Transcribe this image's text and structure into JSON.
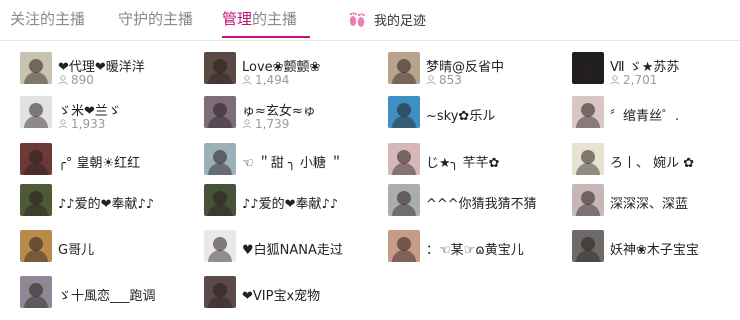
{
  "tabs": [
    {
      "label": "关注的主播"
    },
    {
      "label": "守护的主播"
    },
    {
      "label_highlight": "管理",
      "label_rest": "的主播"
    },
    {
      "label": "我的足迹"
    }
  ],
  "colors": {
    "accent": "#c4127a",
    "count": "#9b9b9b"
  },
  "icons": {
    "footprints": "footprints-icon",
    "person": "person-icon"
  },
  "anchors": [
    {
      "name": "❤代理❤暖洋洋",
      "count": "890",
      "avatar_color": "#c9c2b0"
    },
    {
      "name": "Love❀颤颤❀",
      "count": "1,494",
      "avatar_color": "#5a4a44"
    },
    {
      "name": "梦晴@反省中",
      "count": "853",
      "avatar_color": "#b9a38a"
    },
    {
      "name": "Ⅶ ゞ★苏苏",
      "count": "2,701",
      "avatar_color": "#1f1f1f"
    },
    {
      "name": "ゞ米❤兰ゞ",
      "count": "1,933",
      "avatar_color": "#e2e2e2"
    },
    {
      "name": "ゅ≈玄女≈ゅ",
      "count": "1,739",
      "avatar_color": "#7d6c7a"
    },
    {
      "name": "~sky✿乐ル",
      "count": "",
      "avatar_color": "#3d8fc4"
    },
    {
      "name": "〞绾青丝゜.",
      "count": "",
      "avatar_color": "#d8c6c3"
    },
    {
      "name": "╭° 皇朝☀红红",
      "count": "",
      "avatar_color": "#6b3a36"
    },
    {
      "name": "☜ ＂甜 ╮ 小糖 ＂",
      "count": "",
      "avatar_color": "#9cb0b8"
    },
    {
      "name": "じ★╮ 芊芊✿",
      "count": "",
      "avatar_color": "#d6b8b8"
    },
    {
      "name": "ろ丨、 婉ル ✿",
      "count": "",
      "avatar_color": "#e8e2d0"
    },
    {
      "name": "♪♪爱的❤奉献♪♪",
      "count": "",
      "avatar_color": "#4d5a35"
    },
    {
      "name": "♪♪爱的❤奉献♪♪",
      "count": "",
      "avatar_color": "#47523a"
    },
    {
      "name": "^^^你猜我猜不猜",
      "count": "",
      "avatar_color": "#a9adae"
    },
    {
      "name": "深深深、深蓝",
      "count": "",
      "avatar_color": "#c8b5b6"
    },
    {
      "name": "G哥儿",
      "count": "",
      "avatar_color": "#b98a4a"
    },
    {
      "name": "♥白狐NANA走过",
      "count": "",
      "avatar_color": "#e9e9e9"
    },
    {
      "name": "：☜某☞ɷ黄宝儿",
      "count": "",
      "avatar_color": "#c79c87"
    },
    {
      "name": "妖神❀木子宝宝",
      "count": "",
      "avatar_color": "#6d6a68"
    },
    {
      "name": "ゞ十風恋___跑调",
      "count": "",
      "avatar_color": "#8f8696"
    },
    {
      "name": "❤VIP宝x宠物",
      "count": "",
      "avatar_color": "#5a4a4a"
    }
  ]
}
